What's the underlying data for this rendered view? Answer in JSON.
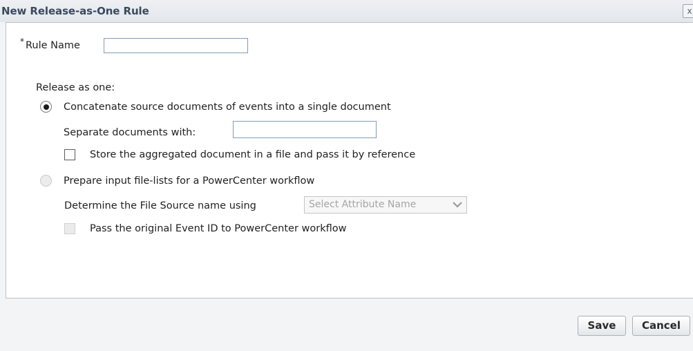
{
  "dialog": {
    "title": "New Release-as-One Rule",
    "close_symbol": "x"
  },
  "rule_name": {
    "required_mark": "*",
    "label": "Rule Name",
    "value": ""
  },
  "release": {
    "heading": "Release as one:",
    "option_concat": {
      "label": "Concatenate source documents of events into a single document",
      "selected": true,
      "separator_label": "Separate documents with:",
      "separator_value": "",
      "store_label": "Store the aggregated document in a file and pass it by reference",
      "store_checked": false
    },
    "option_filelist": {
      "label": "Prepare input file-lists for a PowerCenter workflow",
      "selected": false,
      "source_label": "Determine the File Source name using",
      "select_value": "Select Attribute Name",
      "pass_label": "Pass the original Event ID to PowerCenter workflow",
      "pass_checked": false
    }
  },
  "buttons": {
    "save": "Save",
    "cancel": "Cancel"
  },
  "icons": {
    "close": "close-icon",
    "dropdown": "chevron-down-icon"
  },
  "colors": {
    "title_text": "#3a4a5e",
    "panel_border": "#b7c0ca",
    "disabled_text": "#a5a5a5"
  }
}
